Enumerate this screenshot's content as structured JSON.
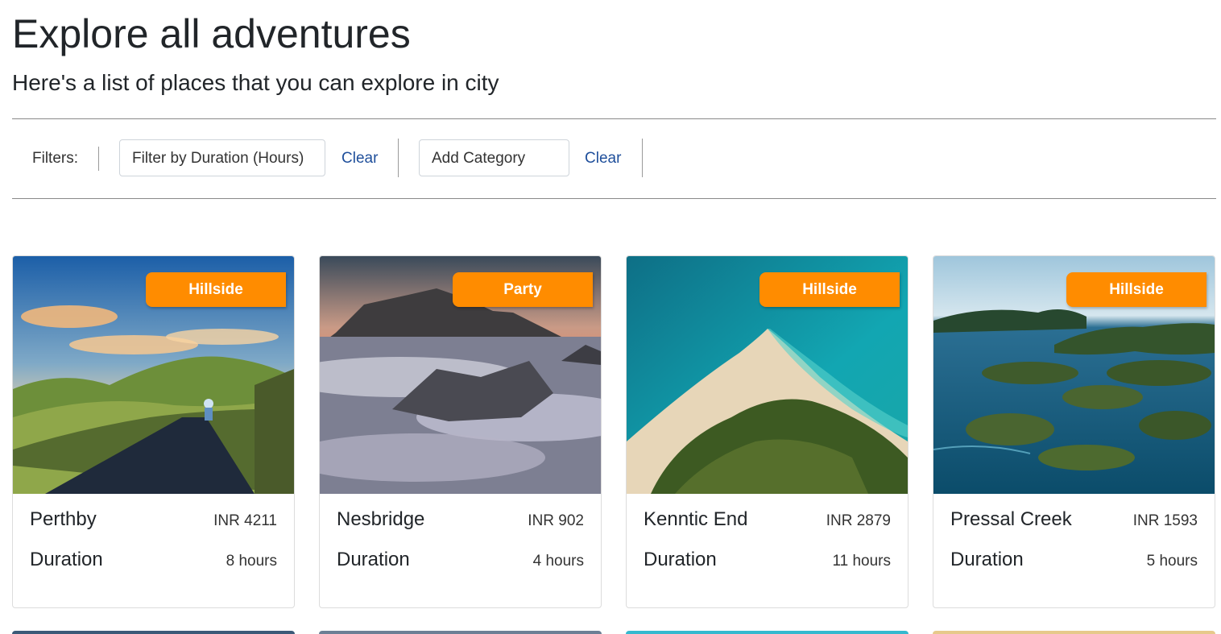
{
  "header": {
    "title": "Explore all adventures",
    "subtitle": "Here's a list of places that you can explore in city"
  },
  "filters": {
    "label": "Filters:",
    "duration_select": "Filter by Duration (Hours)",
    "duration_clear": "Clear",
    "category_select": "Add Category",
    "category_clear": "Clear"
  },
  "colors": {
    "banner": "#ff8c00",
    "link": "#1f4f9b"
  },
  "adventures": [
    {
      "category": "Hillside",
      "name": "Perthby",
      "price": "INR 4211",
      "duration_label": "Duration",
      "duration": "8 hours",
      "image": "cyclist-on-hill-road-image"
    },
    {
      "category": "Party",
      "name": "Nesbridge",
      "price": "INR 902",
      "duration_label": "Duration",
      "duration": "4 hours",
      "image": "mountain-above-clouds-image"
    },
    {
      "category": "Hillside",
      "name": "Kenntic End",
      "price": "INR 2879",
      "duration_label": "Duration",
      "duration": "11 hours",
      "image": "beach-spit-aerial-image"
    },
    {
      "category": "Hillside",
      "name": "Pressal Creek",
      "price": "INR 1593",
      "duration_label": "Duration",
      "duration": "5 hours",
      "image": "island-lagoon-aerial-image"
    }
  ]
}
